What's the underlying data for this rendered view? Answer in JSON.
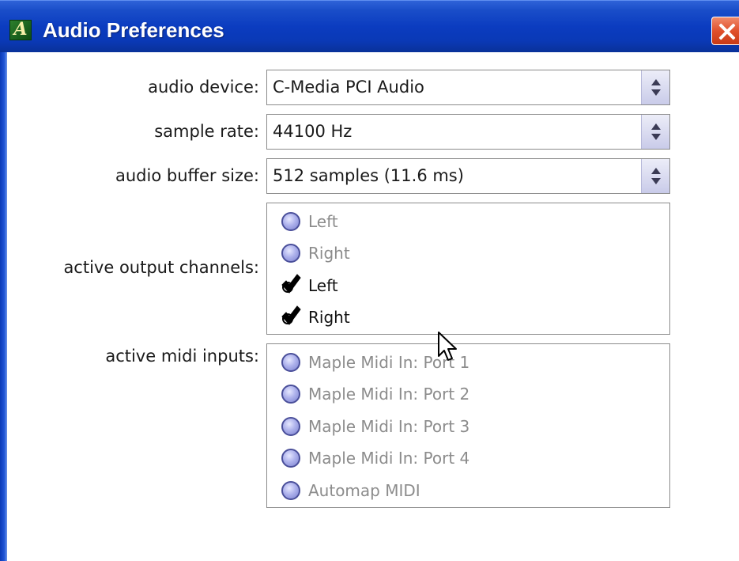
{
  "window": {
    "title": "Audio Preferences",
    "app_icon_glyph": "A"
  },
  "form": {
    "audio_device": {
      "label": "audio device:",
      "value": "C-Media PCI Audio"
    },
    "sample_rate": {
      "label": "sample rate:",
      "value": "44100 Hz"
    },
    "buffer_size": {
      "label": "audio buffer size:",
      "value": "512 samples (11.6 ms)"
    },
    "output_channels": {
      "label": "active output channels:",
      "items": [
        {
          "label": "Left",
          "checked": false
        },
        {
          "label": "Right",
          "checked": false
        },
        {
          "label": "Left",
          "checked": true
        },
        {
          "label": "Right",
          "checked": true
        }
      ]
    },
    "midi_inputs": {
      "label": "active midi inputs:",
      "items": [
        {
          "label": "Maple Midi In: Port 1",
          "checked": false
        },
        {
          "label": "Maple Midi In: Port 2",
          "checked": false
        },
        {
          "label": "Maple Midi In: Port 3",
          "checked": false
        },
        {
          "label": "Maple Midi In: Port 4",
          "checked": false
        },
        {
          "label": "Automap MIDI",
          "checked": false
        }
      ]
    }
  },
  "icons": {
    "app": "app-logo-icon",
    "close": "close-icon",
    "dropdown": "up-down-arrows-icon",
    "unchecked": "radio-unchecked-icon",
    "checked": "checkmark-icon",
    "cursor": "mouse-pointer-icon"
  },
  "colors": {
    "titlebar": "#0a39b6",
    "close_button": "#e0502c",
    "radio_fill": "#aeb2ec"
  }
}
